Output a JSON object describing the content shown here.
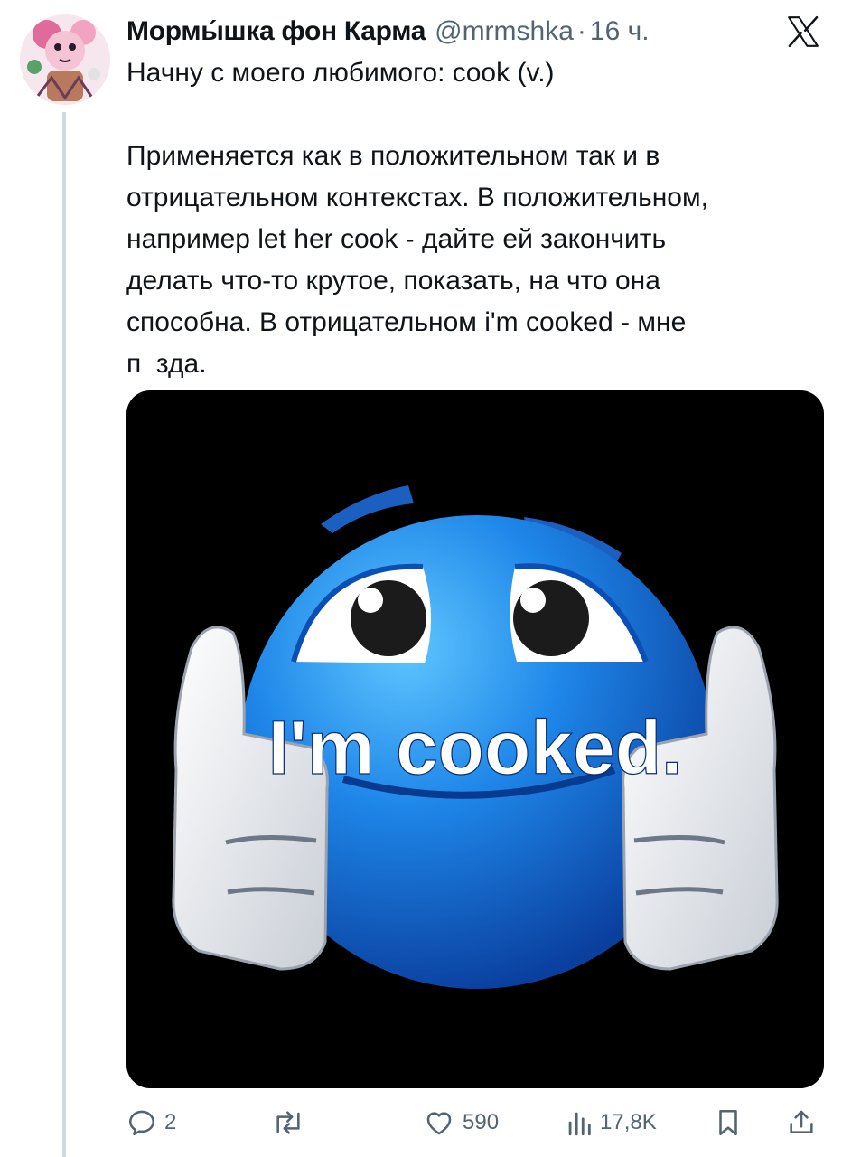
{
  "tweet": {
    "author_name": "Мормы́шка фон Карма",
    "handle": "@mrmshka",
    "separator": "·",
    "time": "16 ч.",
    "text_lines": [
      "Начну с моего любимого: cook (v.)",
      "",
      "Применяется как в положительном так и в",
      "отрицательном контекстах. В положительном,",
      "например let her cook - дайте ей закончить",
      "делать что-то крутое, показать, на что она",
      "способна. В отрицательном i'm cooked - мне",
      "п  зда."
    ],
    "image_caption": "I'm cooked."
  },
  "actions": {
    "replies": "2",
    "retweets": "",
    "likes": "590",
    "views": "17,8K"
  },
  "icons": {
    "reply": "reply-icon",
    "retweet": "retweet-icon",
    "like": "heart-icon",
    "views": "views-icon",
    "bookmark": "bookmark-icon",
    "share": "share-icon",
    "close": "x-logo-icon"
  },
  "colors": {
    "text": "#0f1419",
    "secondary": "#536471",
    "thread_line": "#cfd9de",
    "media_bg": "#000000",
    "emoji_blue": "#1a73d9"
  }
}
